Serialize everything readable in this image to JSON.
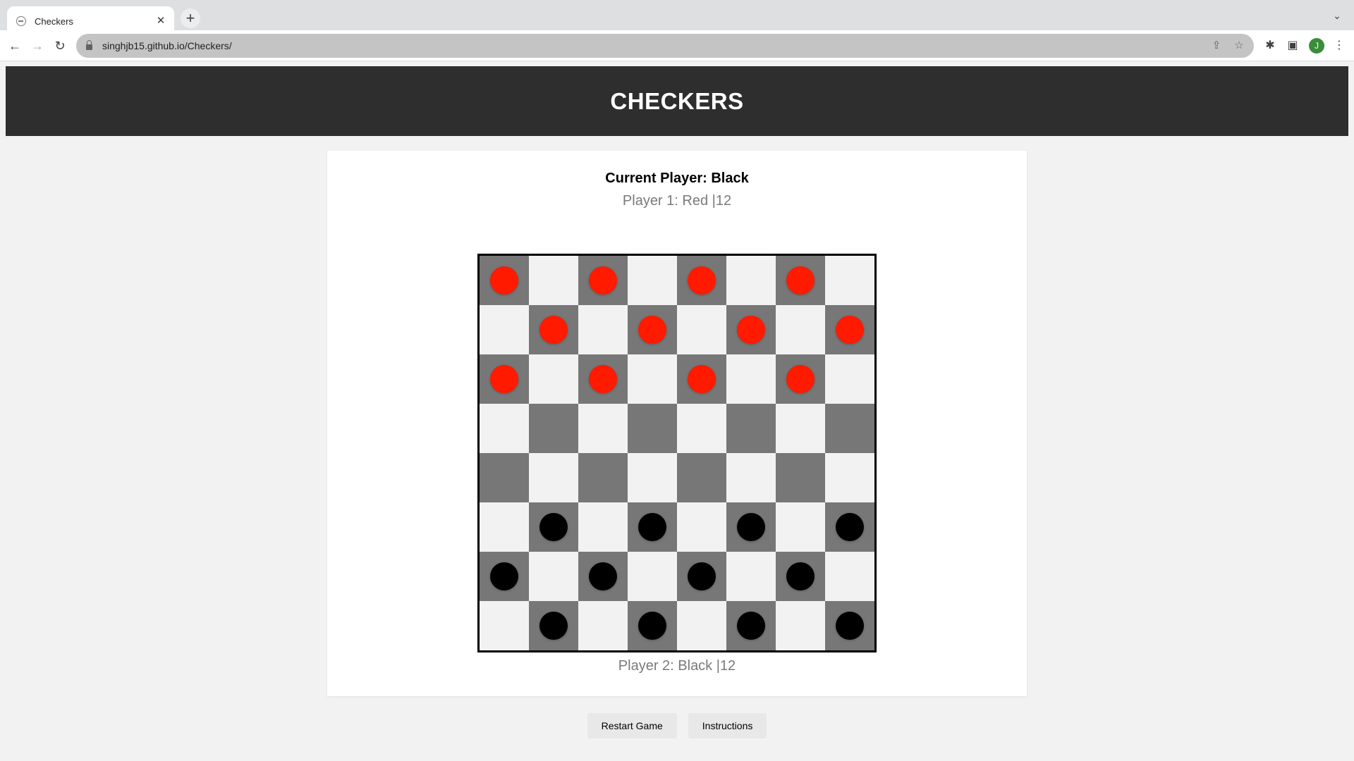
{
  "browser": {
    "tab_title": "Checkers",
    "url": "singhjb15.github.io/Checkers/",
    "profile_initial": "J"
  },
  "page": {
    "title": "CHECKERS",
    "current_player": "Current Player: Black",
    "player1": "Player 1: Red |12",
    "player2": "Player 2: Black |12"
  },
  "board": {
    "size": 8,
    "colors": {
      "dark": "#777777",
      "light": "#f2f2f2",
      "red": "#ff1a00",
      "black": "#000000"
    },
    "rows": [
      [
        "R",
        "",
        "R",
        "",
        "R",
        "",
        "R",
        ""
      ],
      [
        "",
        "R",
        "",
        "R",
        "",
        "R",
        "",
        "R"
      ],
      [
        "R",
        "",
        "R",
        "",
        "R",
        "",
        "R",
        ""
      ],
      [
        "",
        "",
        "",
        "",
        "",
        "",
        "",
        ""
      ],
      [
        "",
        "",
        "",
        "",
        "",
        "",
        "",
        ""
      ],
      [
        "",
        "B",
        "",
        "B",
        "",
        "B",
        "",
        "B"
      ],
      [
        "B",
        "",
        "B",
        "",
        "B",
        "",
        "B",
        ""
      ],
      [
        "",
        "B",
        "",
        "B",
        "",
        "B",
        "",
        "B"
      ]
    ]
  },
  "buttons": {
    "restart": "Restart Game",
    "instructions": "Instructions"
  }
}
